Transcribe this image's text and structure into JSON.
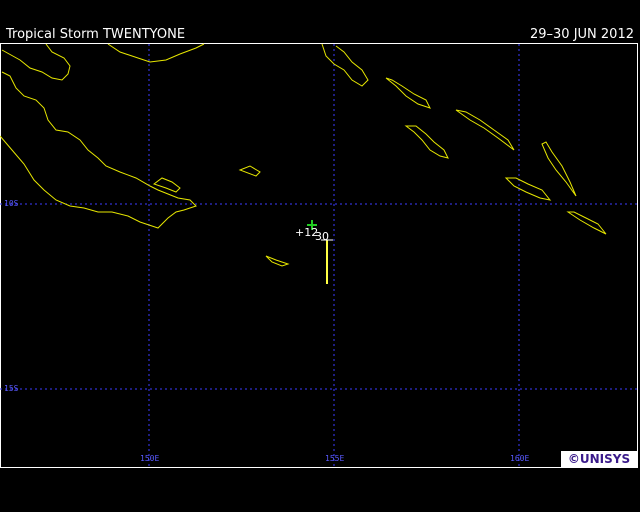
{
  "header": {
    "title": "Tropical Storm TWENTYONE",
    "date_range": "29–30 JUN 2012"
  },
  "map": {
    "latitude_labels": [
      "10S",
      "15S"
    ],
    "longitude_labels": [
      "150E",
      "155E",
      "160E"
    ],
    "coastline_color": "#e6e600",
    "grid_color": "#3c3cff"
  },
  "track": {
    "forecast_label": "+12",
    "time_label": "30",
    "current_marker_color": "#22cc22",
    "track_color": "#ffff44"
  },
  "logo": {
    "text": "©UNISYS"
  }
}
